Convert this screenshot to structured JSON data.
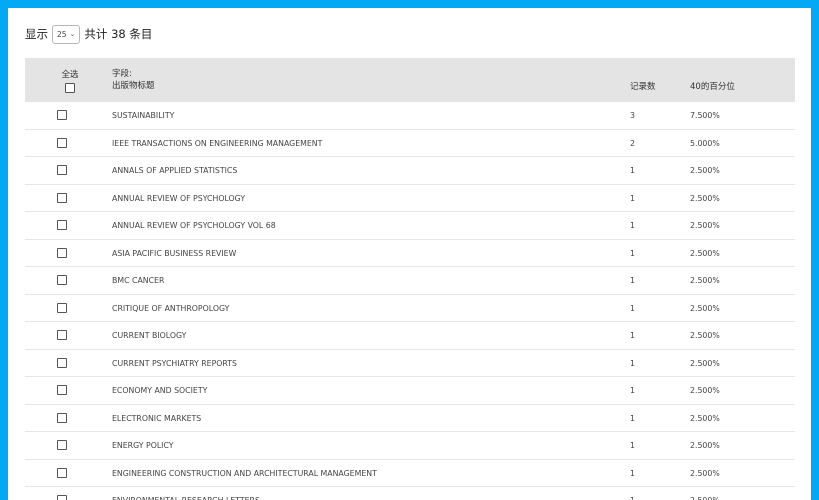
{
  "show": {
    "prefix": "显示",
    "page_size": "25",
    "total": "共计 38 条目"
  },
  "table": {
    "select_all": "全选",
    "field_label": "字段:",
    "field_name": "出版物标题",
    "count_header": "记录数",
    "pct_header": "40的百分位",
    "rows": [
      {
        "name": "SUSTAINABILITY",
        "count": "3",
        "pct": "7.500%"
      },
      {
        "name": "IEEE TRANSACTIONS ON ENGINEERING MANAGEMENT",
        "count": "2",
        "pct": "5.000%"
      },
      {
        "name": "ANNALS OF APPLIED STATISTICS",
        "count": "1",
        "pct": "2.500%"
      },
      {
        "name": "ANNUAL REVIEW OF PSYCHOLOGY",
        "count": "1",
        "pct": "2.500%"
      },
      {
        "name": "ANNUAL REVIEW OF PSYCHOLOGY VOL 68",
        "count": "1",
        "pct": "2.500%"
      },
      {
        "name": "ASIA PACIFIC BUSINESS REVIEW",
        "count": "1",
        "pct": "2.500%"
      },
      {
        "name": "BMC CANCER",
        "count": "1",
        "pct": "2.500%"
      },
      {
        "name": "CRITIQUE OF ANTHROPOLOGY",
        "count": "1",
        "pct": "2.500%"
      },
      {
        "name": "CURRENT BIOLOGY",
        "count": "1",
        "pct": "2.500%"
      },
      {
        "name": "CURRENT PSYCHIATRY REPORTS",
        "count": "1",
        "pct": "2.500%"
      },
      {
        "name": "ECONOMY AND SOCIETY",
        "count": "1",
        "pct": "2.500%"
      },
      {
        "name": "ELECTRONIC MARKETS",
        "count": "1",
        "pct": "2.500%"
      },
      {
        "name": "ENERGY POLICY",
        "count": "1",
        "pct": "2.500%"
      },
      {
        "name": "ENGINEERING CONSTRUCTION AND ARCHITECTURAL MANAGEMENT",
        "count": "1",
        "pct": "2.500%"
      },
      {
        "name": "ENVIRONMENTAL RESEARCH LETTERS",
        "count": "1",
        "pct": "2.500%"
      }
    ]
  }
}
